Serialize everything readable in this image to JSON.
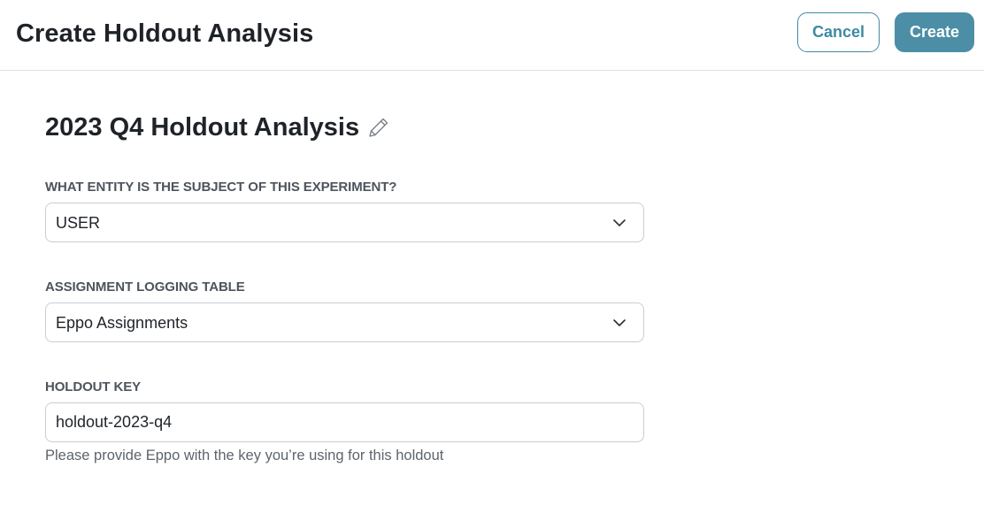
{
  "header": {
    "title": "Create Holdout Analysis",
    "cancel_label": "Cancel",
    "create_label": "Create"
  },
  "analysis": {
    "title": "2023 Q4 Holdout Analysis",
    "edit_icon": "pencil-icon"
  },
  "form": {
    "entity": {
      "label": "WHAT ENTITY IS THE SUBJECT OF THIS EXPERIMENT?",
      "value": "USER"
    },
    "assignment_table": {
      "label": "ASSIGNMENT LOGGING TABLE",
      "value": "Eppo Assignments"
    },
    "holdout_key": {
      "label": "HOLDOUT KEY",
      "value": "holdout-2023-q4",
      "helper": "Please provide Eppo with the key you’re using for this holdout"
    }
  },
  "colors": {
    "accent": "#4c8ea6",
    "accent_border": "#3f8aa4",
    "label": "#4d545c",
    "border": "#c9cdd2"
  }
}
